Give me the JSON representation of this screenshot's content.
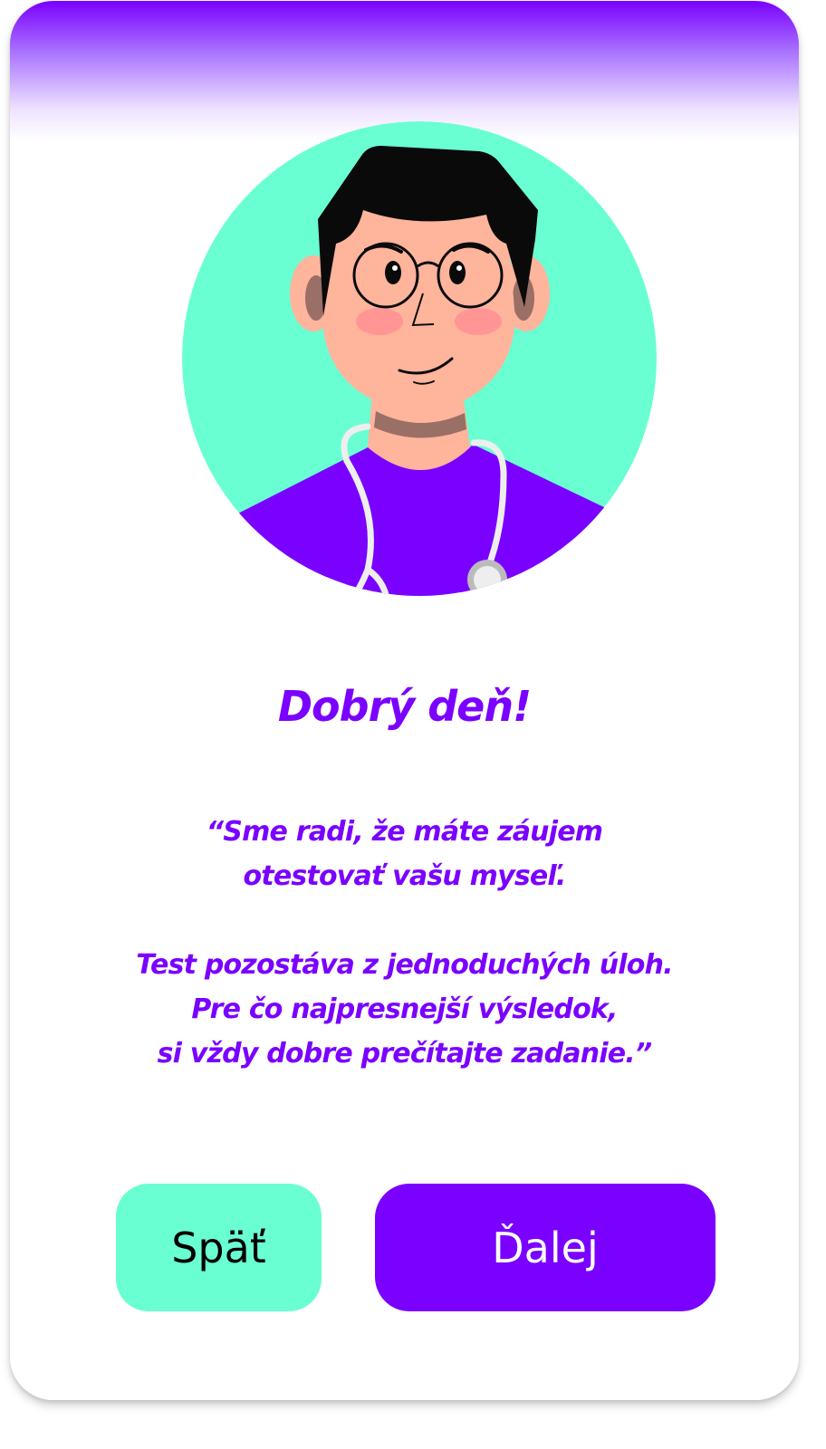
{
  "greeting": "Dobrý deň!",
  "message": {
    "lines_1": [
      "“Sme radi, že máte záujem",
      "otestovať vašu myseľ."
    ],
    "lines_2": [
      "Test pozostáva z jednoduchých úloh.",
      "Pre čo najpresnejší výsledok,",
      "si vždy dobre prečítajte zadanie.”"
    ]
  },
  "buttons": {
    "back_label": "Späť",
    "next_label": "Ďalej"
  },
  "avatar": {
    "icon": "doctor-avatar-icon"
  },
  "colors": {
    "accent": "#7a00ff",
    "mint": "#69ffd2",
    "skin": "#ffb49c",
    "hair": "#0a0a0a"
  }
}
